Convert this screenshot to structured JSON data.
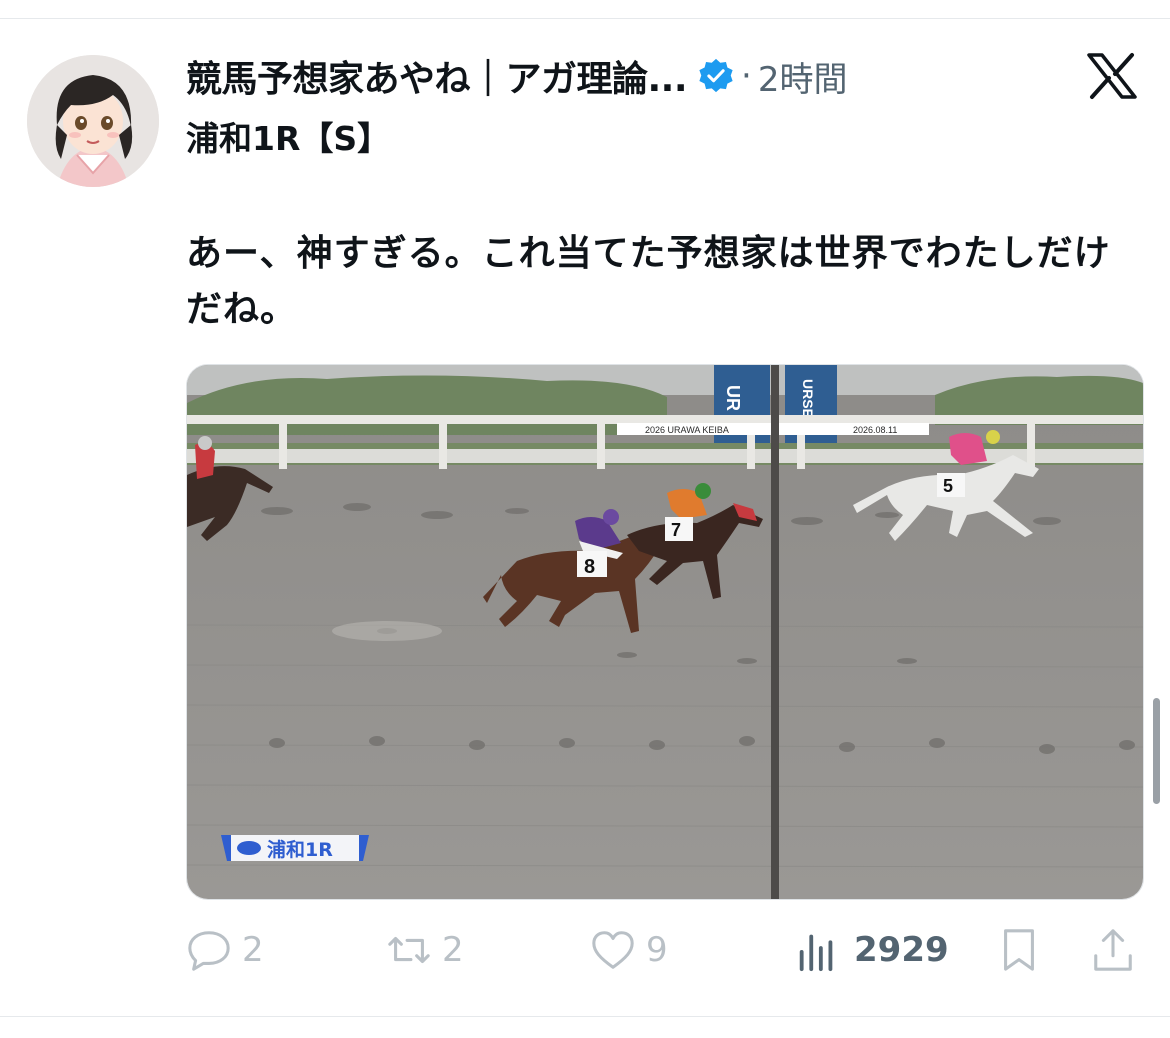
{
  "post": {
    "author_name": "競馬予想家あやね｜アガ理論...",
    "separator": "·",
    "time_ago": "2時間",
    "subtitle": "浦和1R【S】",
    "text": "あー、神すぎる。これ当てた予想家は世界でわたしだけだね。"
  },
  "media": {
    "race_label": "浦和1R",
    "rail_banner_left": "2026 URAWA KEIBA",
    "rail_banner_right": "2026.08.11",
    "board_left": "UR",
    "board_right": "URSE",
    "saddle_numbers": [
      "8",
      "7",
      "5"
    ]
  },
  "actions": {
    "replies": "2",
    "reposts": "2",
    "likes": "9",
    "views": "2929"
  },
  "icons": [
    "verified-badge-icon",
    "x-logo-icon",
    "reply-icon",
    "repost-icon",
    "like-icon",
    "views-icon",
    "bookmark-icon",
    "share-icon"
  ],
  "colors": {
    "verified": "#1d9bf0",
    "muted": "#536471",
    "text": "#0f1419"
  }
}
